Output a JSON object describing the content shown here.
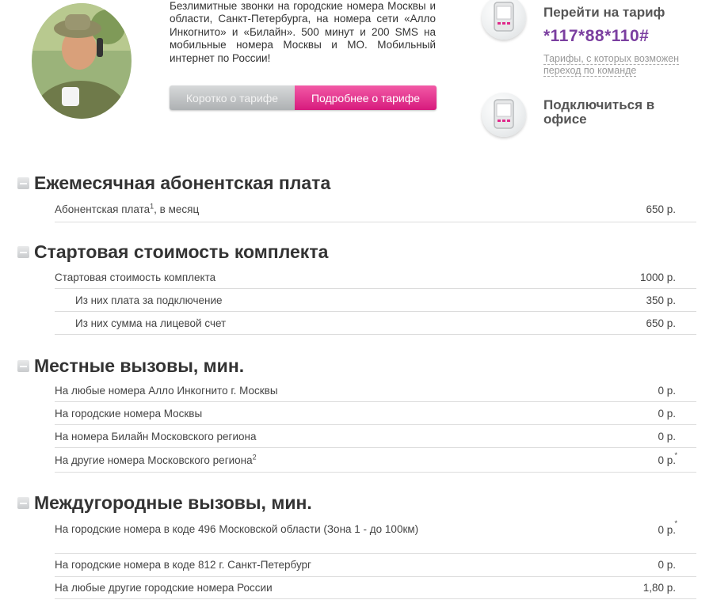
{
  "intro": {
    "text": "Безлимитные звонки на городские номера Москвы и области, Санкт-Петербурга, на номера сети «Алло Инкогнито» и «Билайн». 500 минут и 200 SMS на мобильные номера Москвы и МО. Мобильный интернет по России!"
  },
  "tabs": {
    "short": "Коротко о тарифе",
    "detail": "Подробнее о тарифе"
  },
  "switch": {
    "title": "Перейти на тариф",
    "code": "*117*88*110#",
    "link": "Тарифы, с которых возможен переход по команде"
  },
  "office": {
    "title": "Подключиться в офисе"
  },
  "icons": {
    "phone": "phone-icon",
    "toggle": "collapse-icon"
  },
  "colors": {
    "accent_pink": "#e0288a",
    "code_purple": "#7b3fa0"
  },
  "sections": [
    {
      "title": "Ежемесячная абонентская плата",
      "rows": [
        {
          "label": "Абонентская плата",
          "note": "1",
          "label_suffix": ", в месяц",
          "price": "650 р."
        }
      ]
    },
    {
      "title": "Стартовая стоимость комплекта",
      "rows": [
        {
          "label": "Стартовая стоимость комплекта",
          "price": "1000 р."
        },
        {
          "label": "Из них плата за подключение",
          "price": "350 р."
        },
        {
          "label": "Из них сумма на лицевой счет",
          "price": "650 р."
        }
      ]
    },
    {
      "title": "Местные вызовы, мин.",
      "rows": [
        {
          "label": "На любые номера Алло Инкогнито г. Москвы",
          "price": "0 р."
        },
        {
          "label": "На городские номера Москвы",
          "price": "0 р."
        },
        {
          "label": "На номера Билайн Московского региона",
          "price": "0 р."
        },
        {
          "label": "На другие номера Московского региона",
          "note": "2",
          "price": "0 р.",
          "star": "*"
        }
      ]
    },
    {
      "title": "Междугородные вызовы, мин.",
      "rows": [
        {
          "label": "На городские номера в коде 496 Московской области (Зона 1 - до 100км)",
          "price": "0 р.",
          "star": "*"
        },
        {
          "label": "На городские номера в коде 812 г. Санкт-Петербург",
          "price": "0 р."
        },
        {
          "label": "На любые другие городские номера России",
          "price": "1,80 р."
        }
      ]
    }
  ]
}
